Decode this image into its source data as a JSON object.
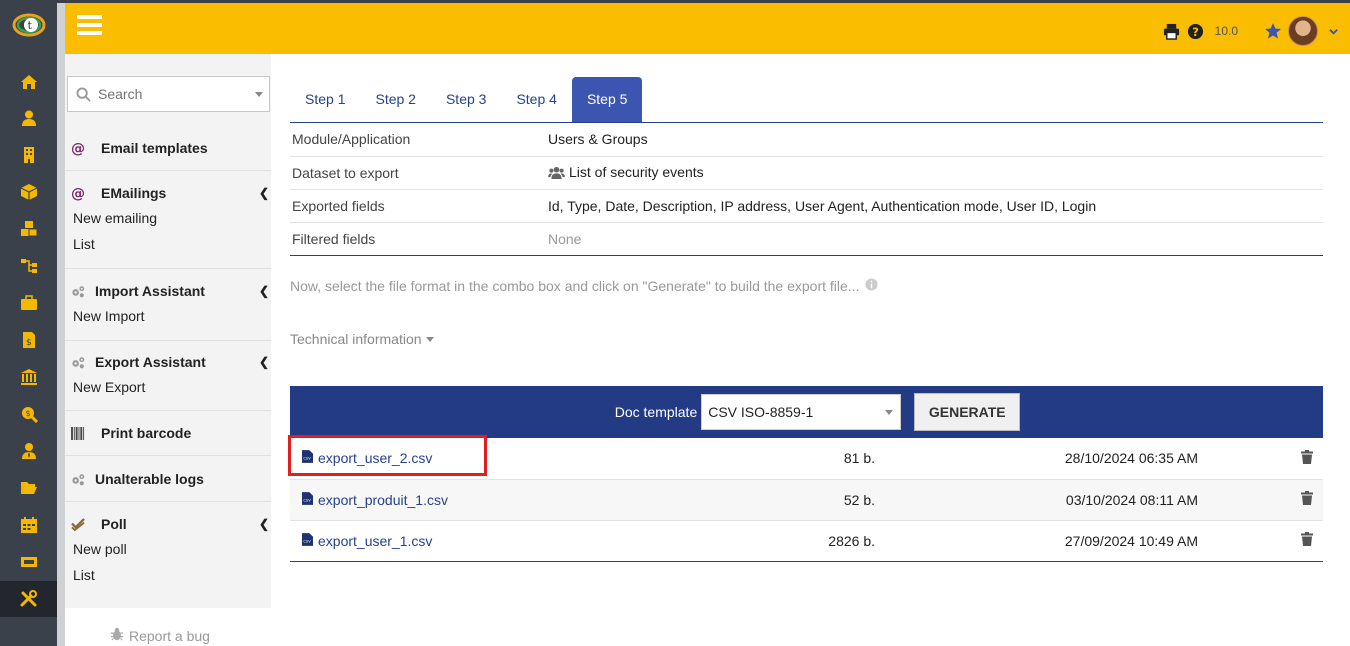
{
  "rail": {
    "items": [
      "home-icon",
      "user-icon",
      "building-icon",
      "box-icon",
      "cubes-icon",
      "sitemap-icon",
      "briefcase-icon",
      "invoice-icon",
      "bank-icon",
      "search-dollar-icon",
      "user-tie-icon",
      "folder-open-icon",
      "calendar-icon",
      "ticket-icon",
      "tools-icon"
    ],
    "active": "tools-icon"
  },
  "topbar": {
    "version": "10.0",
    "colors": {
      "bar": "#fbbd00",
      "rail": "#3b414a"
    }
  },
  "leftmenu": {
    "search_placeholder": "Search",
    "email_templates": "Email templates",
    "emailings": {
      "title": "EMailings",
      "items": [
        "New emailing",
        "List"
      ]
    },
    "import": {
      "title": "Import Assistant",
      "items": [
        "New Import"
      ]
    },
    "export": {
      "title": "Export Assistant",
      "items": [
        "New Export"
      ]
    },
    "barcode": "Print barcode",
    "logs": "Unalterable logs",
    "poll": {
      "title": "Poll",
      "items": [
        "New poll",
        "List"
      ]
    },
    "report_bug": "Report a bug"
  },
  "main": {
    "tabs": [
      "Step 1",
      "Step 2",
      "Step 3",
      "Step 4",
      "Step 5"
    ],
    "active_tab": "Step 5",
    "info": [
      {
        "key": "Module/Application",
        "value": "Users & Groups"
      },
      {
        "key": "Dataset to export",
        "value": "List of security events"
      },
      {
        "key": "Exported fields",
        "value": "Id, Type, Date, Description, IP address, User Agent, Authentication mode, User ID, Login"
      },
      {
        "key": "Filtered fields",
        "value": "None"
      }
    ],
    "note": "Now, select the file format in the combo box and click on \"Generate\" to build the export file...",
    "tech_info": "Technical information",
    "doc_template_label": "Doc template",
    "doc_template_value": "CSV ISO-8859-1",
    "generate_label": "GENERATE",
    "files": [
      {
        "name": "export_user_2.csv",
        "size": "81 b.",
        "date": "28/10/2024 06:35 AM"
      },
      {
        "name": "export_produit_1.csv",
        "size": "52 b.",
        "date": "03/10/2024 08:11 AM"
      },
      {
        "name": "export_user_1.csv",
        "size": "2826 b.",
        "date": "27/09/2024 10:49 AM"
      }
    ]
  }
}
